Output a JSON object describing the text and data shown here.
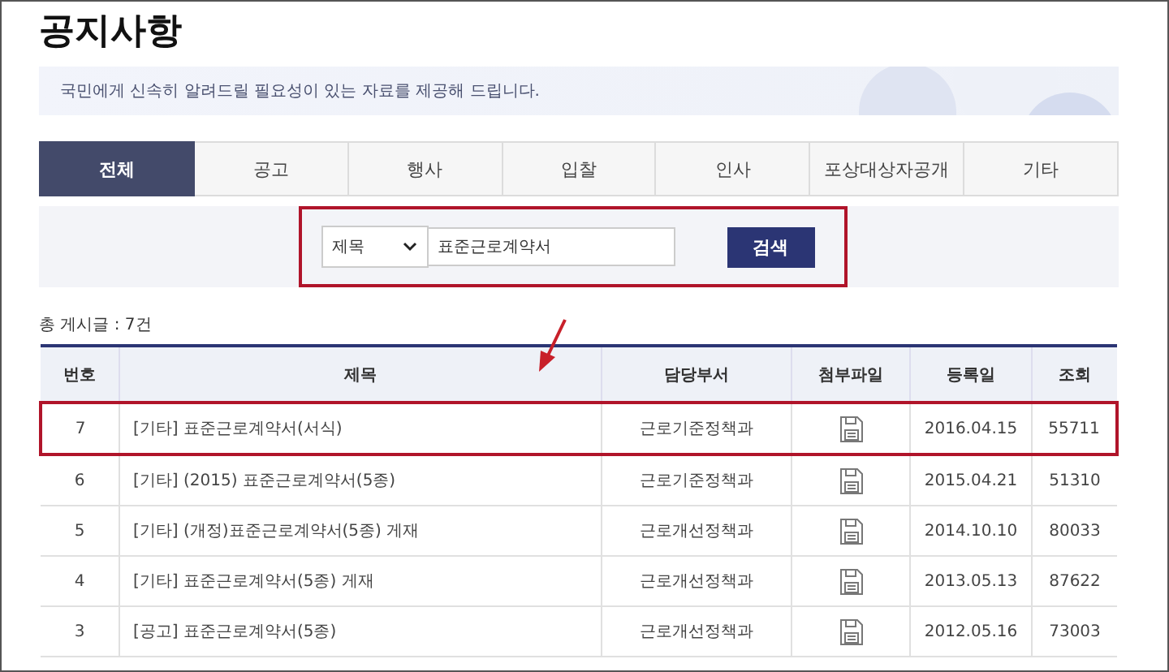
{
  "title": "공지사항",
  "intro": "국민에게 신속히 알려드릴 필요성이 있는 자료를 제공해 드립니다.",
  "tabs": [
    {
      "label": "전체",
      "selected": true
    },
    {
      "label": "공고",
      "selected": false
    },
    {
      "label": "행사",
      "selected": false
    },
    {
      "label": "입찰",
      "selected": false
    },
    {
      "label": "인사",
      "selected": false
    },
    {
      "label": "포상대상자공개",
      "selected": false
    },
    {
      "label": "기타",
      "selected": false
    }
  ],
  "search": {
    "field": "제목",
    "value": "표준근로계약서",
    "button": "검색",
    "highlighted": true
  },
  "total": "총 게시글 : 7건",
  "table": {
    "columns": [
      "번호",
      "제목",
      "담당부서",
      "첨부파일",
      "등록일",
      "조회"
    ],
    "rows": [
      {
        "no": "7",
        "title": "[기타] 표준근로계약서(서식)",
        "dept": "근로기준정책과",
        "attachment": true,
        "date": "2016.04.15",
        "views": "55711",
        "highlighted": true
      },
      {
        "no": "6",
        "title": "[기타] (2015) 표준근로계약서(5종)",
        "dept": "근로기준정책과",
        "attachment": true,
        "date": "2015.04.21",
        "views": "51310",
        "highlighted": false
      },
      {
        "no": "5",
        "title": "[기타] (개정)표준근로계약서(5종) 게재",
        "dept": "근로개선정책과",
        "attachment": true,
        "date": "2014.10.10",
        "views": "80033",
        "highlighted": false
      },
      {
        "no": "4",
        "title": "[기타] 표준근로계약서(5종) 게재",
        "dept": "근로개선정책과",
        "attachment": true,
        "date": "2013.05.13",
        "views": "87622",
        "highlighted": false
      },
      {
        "no": "3",
        "title": "[공고] 표준근로계약서(5종)",
        "dept": "근로개선정책과",
        "attachment": true,
        "date": "2012.05.16",
        "views": "73003",
        "highlighted": false
      }
    ]
  }
}
